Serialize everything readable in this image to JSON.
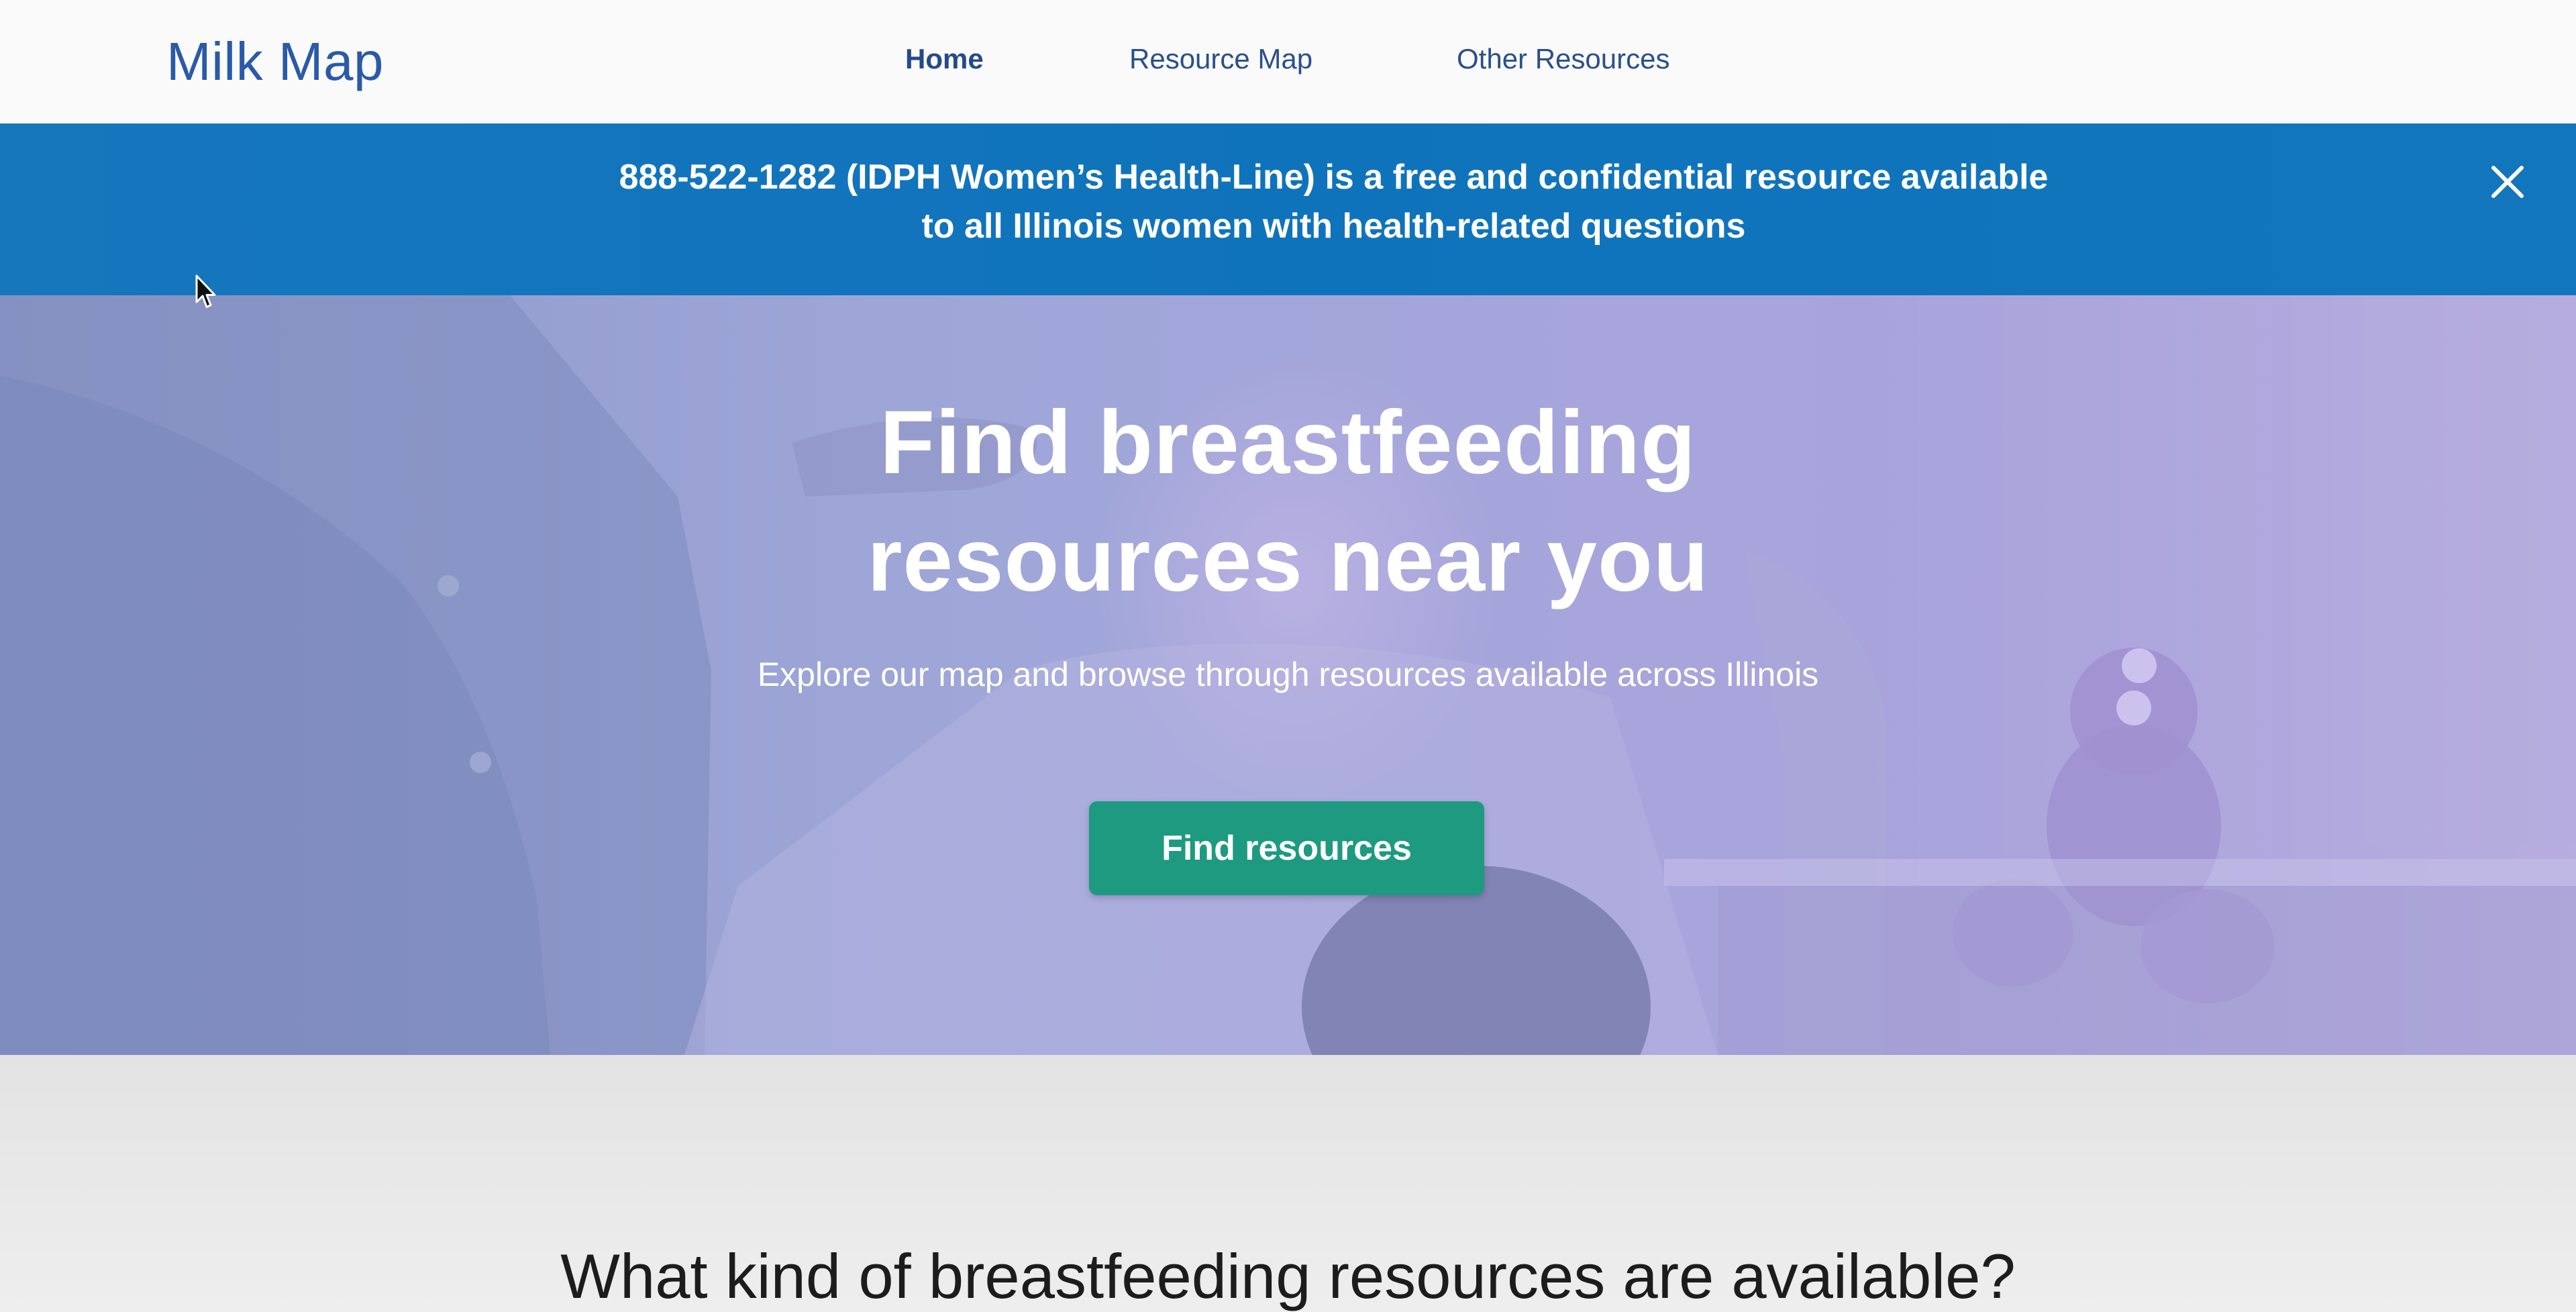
{
  "header": {
    "logo": "Milk Map",
    "nav": [
      {
        "label": "Home",
        "active": true
      },
      {
        "label": "Resource Map",
        "active": false
      },
      {
        "label": "Other Resources",
        "active": false
      }
    ]
  },
  "banner": {
    "line1": "888-522-1282 (IDPH Women’s Health-Line) is a free and confidential resource available",
    "line2": "to all Illinois women with health-related questions",
    "close_icon": "close-icon"
  },
  "hero": {
    "title_line1": "Find breastfeeding",
    "title_line2": "resources near you",
    "subtitle": "Explore our map and browse through resources available across Illinois",
    "cta_label": "Find resources"
  },
  "section": {
    "heading": "What kind of breastfeeding resources are available?"
  },
  "colors": {
    "brand_blue": "#2a5aa8",
    "banner_blue": "#1074bc",
    "cta_green": "#1d9a80",
    "hero_overlay": "#9ea6d8"
  }
}
